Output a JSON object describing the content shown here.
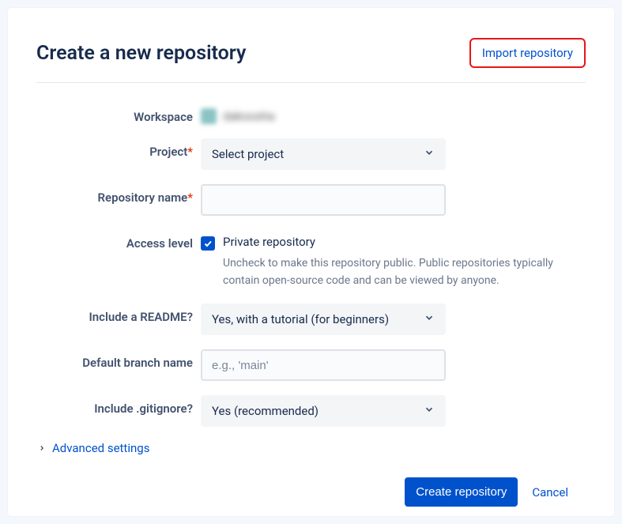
{
  "header": {
    "title": "Create a new repository",
    "import_link": "Import repository"
  },
  "form": {
    "workspace": {
      "label": "Workspace",
      "value": "dakoosha"
    },
    "project": {
      "label": "Project",
      "required_mark": "*",
      "value": "Select project"
    },
    "repo_name": {
      "label": "Repository name",
      "required_mark": "*",
      "value": ""
    },
    "access": {
      "label": "Access level",
      "checkbox_label": "Private repository",
      "helper": "Uncheck to make this repository public. Public repositories typically contain open-source code and can be viewed by anyone.",
      "checked": true
    },
    "readme": {
      "label": "Include a README?",
      "value": "Yes, with a tutorial (for beginners)"
    },
    "branch": {
      "label": "Default branch name",
      "placeholder": "e.g., 'main'",
      "value": ""
    },
    "gitignore": {
      "label": "Include .gitignore?",
      "value": "Yes (recommended)"
    },
    "advanced": "Advanced settings"
  },
  "actions": {
    "create": "Create repository",
    "cancel": "Cancel"
  }
}
